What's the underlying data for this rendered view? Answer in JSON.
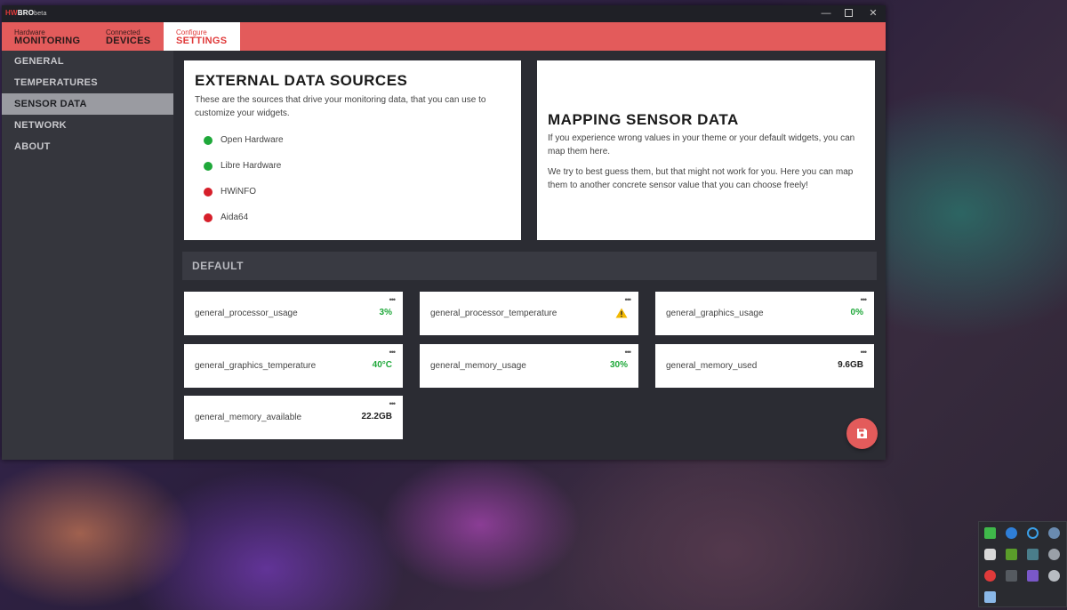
{
  "app": {
    "logo_red": "HW",
    "logo_main": "BRO",
    "logo_beta": "beta"
  },
  "window_controls": {
    "minimize": "—",
    "close": "✕"
  },
  "nav": {
    "tabs": [
      {
        "small": "Hardware",
        "big": "MONITORING"
      },
      {
        "small": "Connected",
        "big": "DEVICES"
      },
      {
        "small": "Configure",
        "big": "SETTINGS"
      }
    ]
  },
  "sidebar": {
    "items": [
      {
        "label": "GENERAL"
      },
      {
        "label": "TEMPERATURES"
      },
      {
        "label": "SENSOR DATA"
      },
      {
        "label": "NETWORK"
      },
      {
        "label": "ABOUT"
      }
    ]
  },
  "external": {
    "title": "EXTERNAL DATA SOURCES",
    "description": "These are the sources that drive your monitoring data, that you can use to customize your widgets.",
    "sources": [
      {
        "name": "Open Hardware",
        "status_color": "#1fa83a"
      },
      {
        "name": "Libre Hardware",
        "status_color": "#1fa83a"
      },
      {
        "name": "HWiNFO",
        "status_color": "#d61f2a"
      },
      {
        "name": "Aida64",
        "status_color": "#d61f2a"
      }
    ]
  },
  "mapping": {
    "title": "MAPPING SENSOR DATA",
    "paragraph1": "If you experience wrong values in your theme or your default widgets, you can map them here.",
    "paragraph2": "We try to best guess them, but that might not work for you. Here you can map them to another concrete sensor value that you can choose freely!"
  },
  "default_section": {
    "title": "DEFAULT"
  },
  "sensors": [
    {
      "name": "general_processor_usage",
      "value": "3%"
    },
    {
      "name": "general_processor_temperature",
      "value": "",
      "icon": "warning-icon"
    },
    {
      "name": "general_graphics_usage",
      "value": "0%"
    },
    {
      "name": "general_graphics_temperature",
      "value": "40°C"
    },
    {
      "name": "general_memory_usage",
      "value": "30%"
    },
    {
      "name": "general_memory_used",
      "value": "9.6GB"
    },
    {
      "name": "general_memory_available",
      "value": "22.2GB"
    }
  ],
  "menu_glyph": "•••",
  "colors": {
    "accent": "#e35b5b",
    "ok": "#1fa83a",
    "error": "#d61f2a",
    "warning": "#f2b800"
  }
}
